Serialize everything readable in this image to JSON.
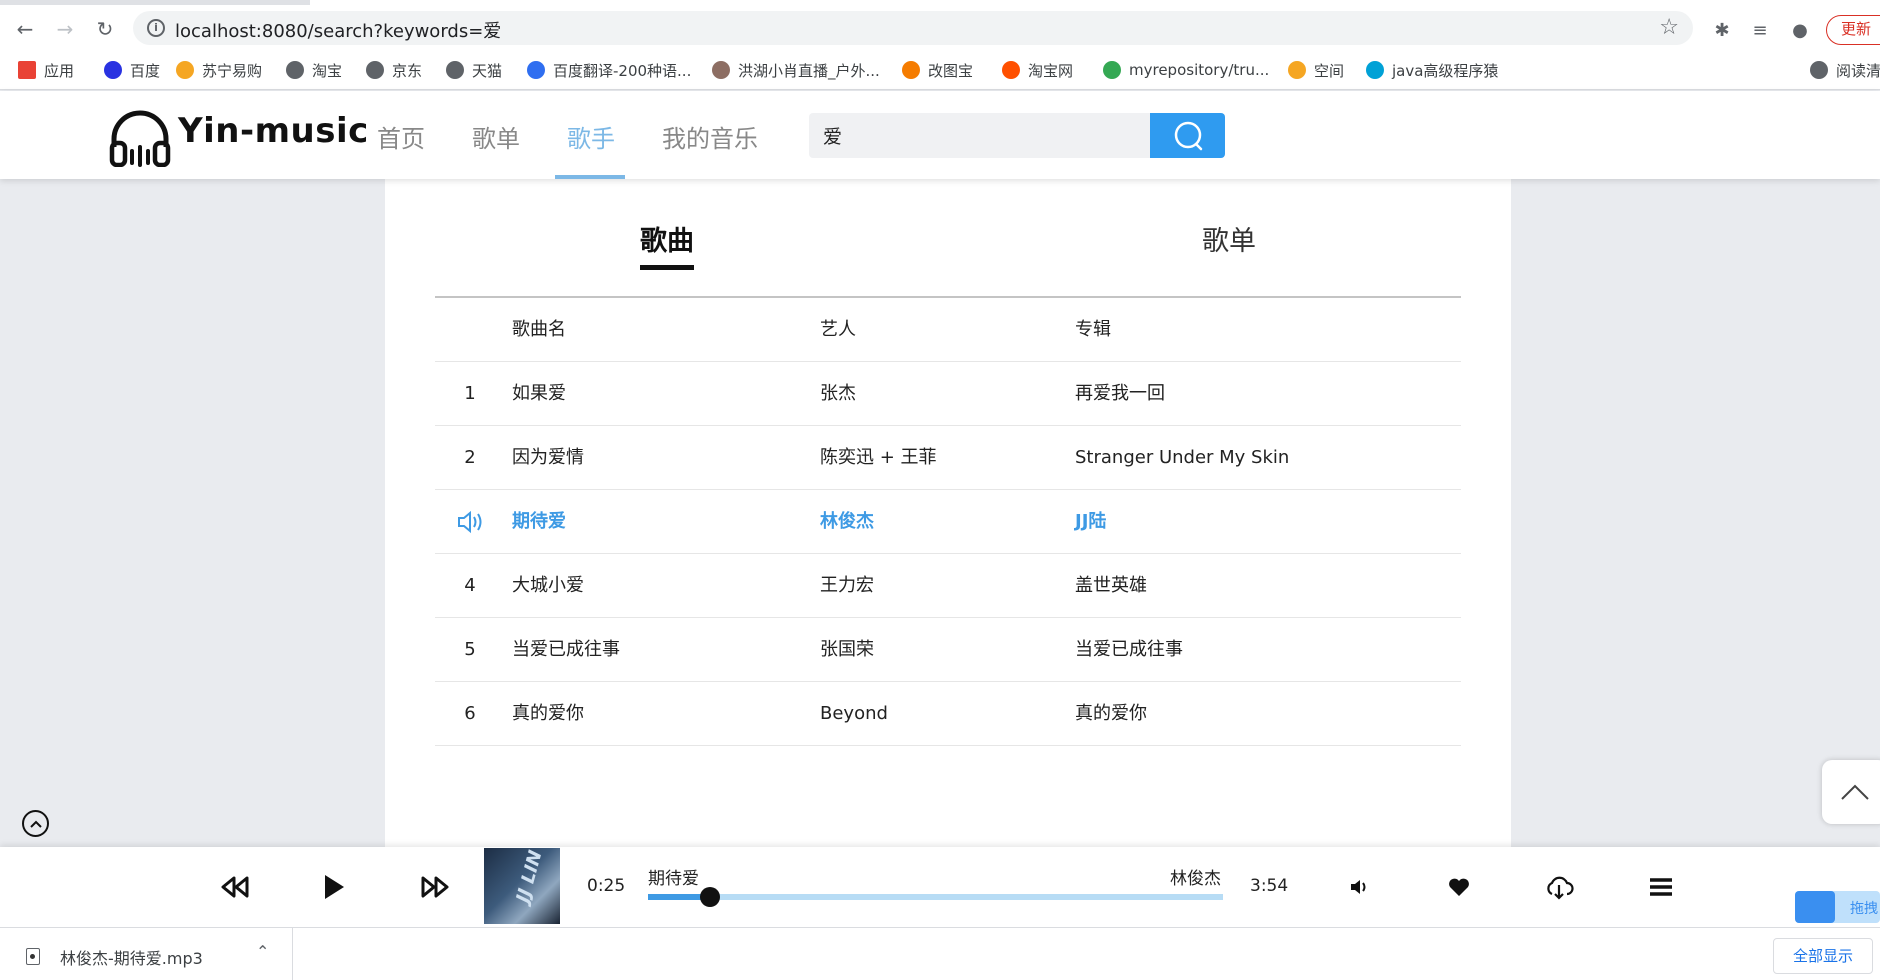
{
  "browser": {
    "url": "localhost:8080/search?keywords=爱",
    "update_label": "更新",
    "bookmarks": [
      {
        "label": "应用",
        "color": "#e94235"
      },
      {
        "label": "百度",
        "color": "#2932e1"
      },
      {
        "label": "苏宁易购",
        "color": "#f5a623"
      },
      {
        "label": "淘宝",
        "color": "#5f6368"
      },
      {
        "label": "京东",
        "color": "#5f6368"
      },
      {
        "label": "天猫",
        "color": "#5f6368"
      },
      {
        "label": "百度翻译-200种语...",
        "color": "#2f6ef0"
      },
      {
        "label": "洪湖小肖直播_户外...",
        "color": "#8d6e63"
      },
      {
        "label": "改图宝",
        "color": "#f57c00"
      },
      {
        "label": "淘宝网",
        "color": "#ff5000"
      },
      {
        "label": "myrepository/tru...",
        "color": "#34a853"
      },
      {
        "label": "空间",
        "color": "#f5a623"
      },
      {
        "label": "java高级程序猿",
        "color": "#00a1d6"
      },
      {
        "label": "阅读清",
        "color": "#5f6368"
      }
    ]
  },
  "header": {
    "logo": "Yin-music",
    "nav": [
      "首页",
      "歌单",
      "歌手",
      "我的音乐"
    ],
    "active_nav": "歌手",
    "search_value": "爱"
  },
  "results": {
    "tabs": [
      "歌曲",
      "歌单"
    ],
    "active_tab": "歌曲",
    "columns": {
      "name": "歌曲名",
      "artist": "艺人",
      "album": "专辑"
    },
    "songs": [
      {
        "index": "1",
        "name": "如果爱",
        "artist": "张杰",
        "album": "再爱我一回"
      },
      {
        "index": "2",
        "name": "因为爱情",
        "artist": "陈奕迅 + 王菲",
        "album": "Stranger Under My Skin"
      },
      {
        "index": "",
        "name": "期待爱",
        "artist": "林俊杰",
        "album": "JJ陆",
        "playing": true
      },
      {
        "index": "4",
        "name": "大城小爱",
        "artist": "王力宏",
        "album": "盖世英雄"
      },
      {
        "index": "5",
        "name": "当爱已成往事",
        "artist": "张国荣",
        "album": "当爱已成往事"
      },
      {
        "index": "6",
        "name": "真的爱你",
        "artist": "Beyond",
        "album": "真的爱你"
      }
    ]
  },
  "player": {
    "current_time": "0:25",
    "duration": "3:54",
    "title": "期待爱",
    "artist": "林俊杰",
    "progress_fraction": 0.107,
    "cover_text": "JJ LIN",
    "accent_color": "#3e9ae4",
    "extension_label": "拖拽"
  },
  "downloads": {
    "file": "林俊杰-期待爱.mp3",
    "show_all": "全部显示"
  }
}
